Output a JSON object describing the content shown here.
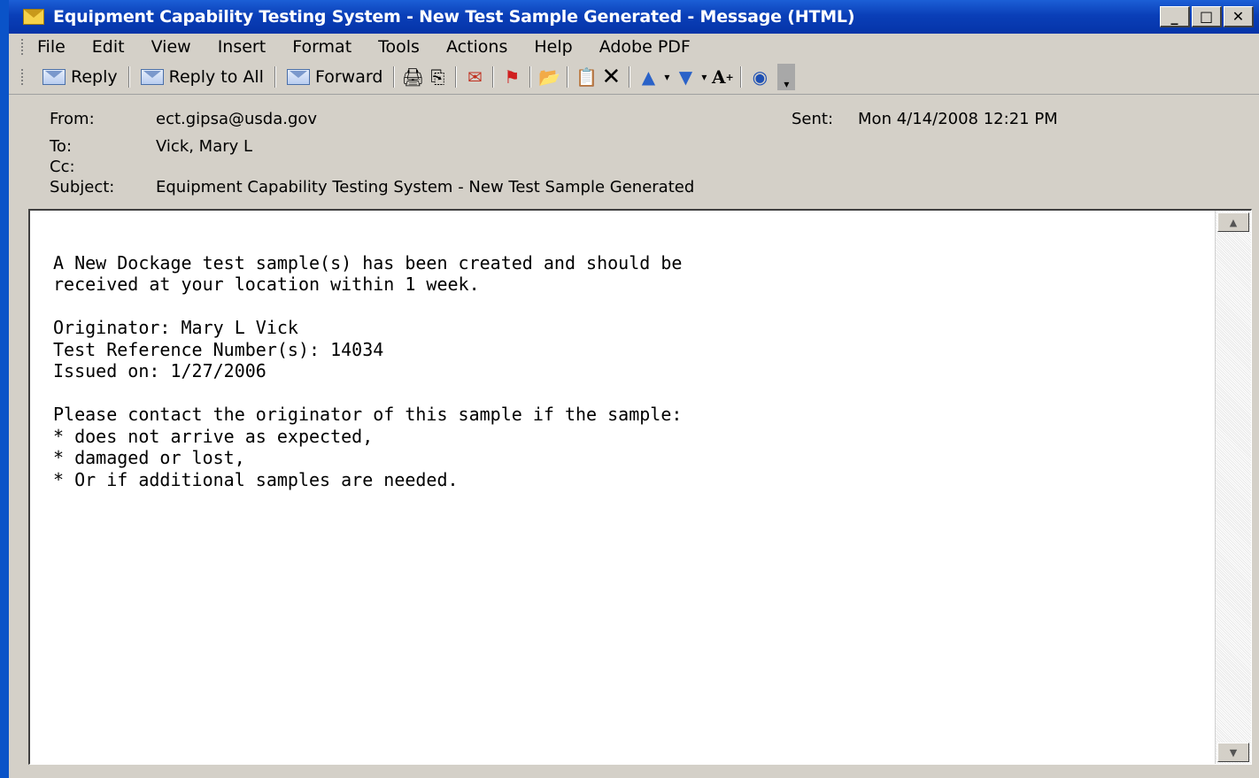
{
  "window": {
    "title": "Equipment Capability Testing System - New Test Sample Generated - Message (HTML)",
    "controls": {
      "minimize": "_",
      "maximize": "□",
      "close": "✕"
    }
  },
  "menu": {
    "items": [
      "File",
      "Edit",
      "View",
      "Insert",
      "Format",
      "Tools",
      "Actions",
      "Help",
      "Adobe PDF"
    ]
  },
  "toolbar": {
    "reply_label": "Reply",
    "reply_all_label": "Reply to All",
    "forward_label": "Forward"
  },
  "header": {
    "from_label": "From:",
    "from_value": "ect.gipsa@usda.gov",
    "to_label": "To:",
    "to_value": "Vick, Mary L",
    "cc_label": "Cc:",
    "cc_value": "",
    "subject_label": "Subject:",
    "subject_value": "Equipment Capability Testing System - New Test Sample Generated",
    "sent_label": "Sent:",
    "sent_value": "Mon 4/14/2008 12:21 PM"
  },
  "body": {
    "lines": [
      "A New Dockage test sample(s) has been created and should be",
      "received at your location within 1 week.",
      "",
      "Originator: Mary L Vick",
      "Test Reference Number(s): 14034",
      "Issued on: 1/27/2006",
      "",
      "Please contact the originator of this sample if the sample:",
      "* does not arrive as expected,",
      "* damaged or lost,",
      "* Or if additional samples are needed."
    ]
  }
}
